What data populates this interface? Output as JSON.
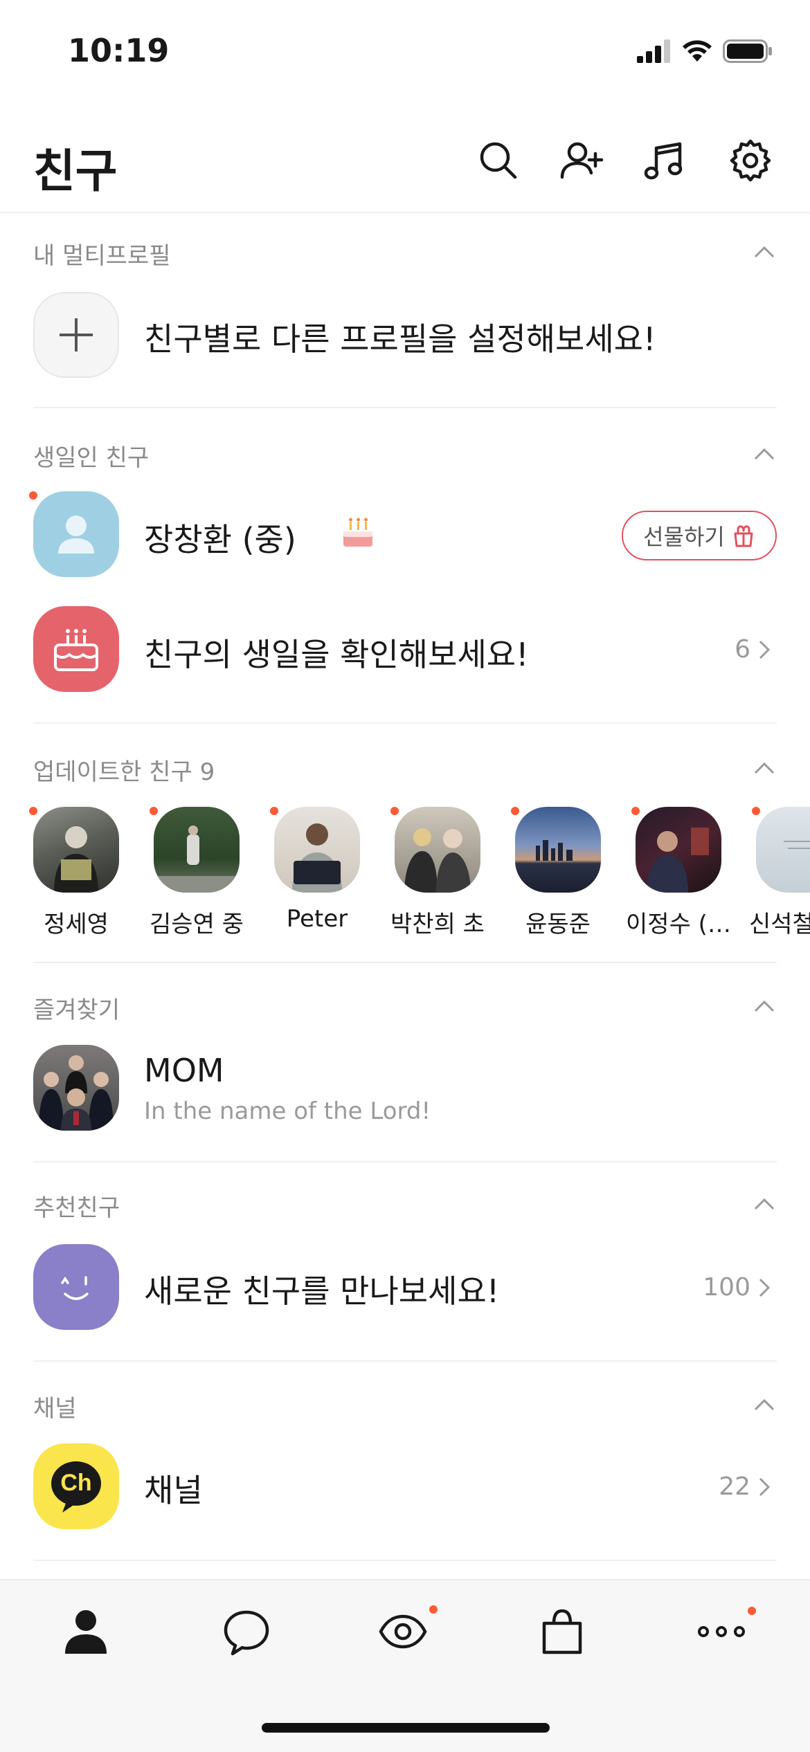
{
  "status_bar": {
    "time": "10:19"
  },
  "header": {
    "title": "친구"
  },
  "multi_profile": {
    "title": "내 멀티프로필",
    "prompt": "친구별로 다른 프로필을 설정해보세요!"
  },
  "birthday": {
    "title": "생일인 친구",
    "friend_name": "장창환 (중)",
    "gift_label": "선물하기",
    "check_prompt": "친구의 생일을 확인해보세요!",
    "check_count": "6"
  },
  "updated": {
    "title": "업데이트한 친구 9",
    "friends": [
      {
        "name": "정세영"
      },
      {
        "name": "김승연 중"
      },
      {
        "name": "Peter"
      },
      {
        "name": "박찬희 초"
      },
      {
        "name": "윤동준"
      },
      {
        "name": "이정수 (…"
      },
      {
        "name": "신석철"
      }
    ]
  },
  "favorites": {
    "title": "즐겨찾기",
    "name": "MOM",
    "status": "In the name of the Lord!"
  },
  "recommended": {
    "title": "추천친구",
    "prompt": "새로운 친구를 만나보세요!",
    "count": "100"
  },
  "channel": {
    "title": "채널",
    "name": "채널",
    "count": "22",
    "logo_text": "Ch"
  },
  "colors": {
    "accent_dot": "#ff5a36",
    "gift_border": "#e0525f",
    "birthday_bg": "#e5636b",
    "recommend_bg": "#8a7fc9",
    "channel_bg": "#fae54d"
  }
}
